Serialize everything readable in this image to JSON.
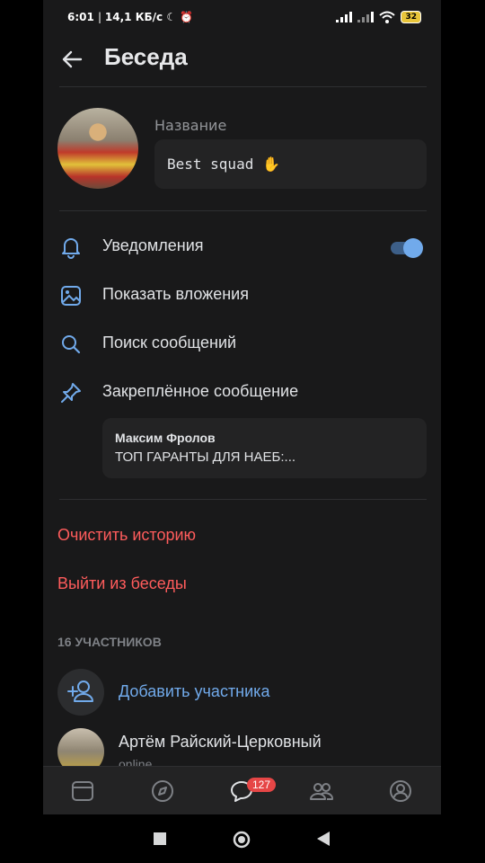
{
  "status_bar": {
    "time": "6:01",
    "network_speed": "14,1 КБ/с",
    "battery": "32"
  },
  "header": {
    "title": "Беседа"
  },
  "chat": {
    "name_label": "Название",
    "name_value": "Best squad"
  },
  "menu": {
    "notifications": "Уведомления",
    "attachments": "Показать вложения",
    "search": "Поиск сообщений",
    "pinned": "Закреплённое сообщение"
  },
  "pinned_message": {
    "author": "Максим Фролов",
    "text": "ТОП ГАРАНТЫ ДЛЯ НАЕБ:..."
  },
  "actions": {
    "clear_history": "Очистить историю",
    "leave": "Выйти из беседы"
  },
  "members": {
    "count_label": "16 УЧАСТНИКОВ",
    "add_label": "Добавить участника",
    "first": {
      "name": "Артём Райский-Церковный",
      "status": "online"
    }
  },
  "tabbar": {
    "messages_badge": "127"
  },
  "colors": {
    "accent": "#71aaeb",
    "danger": "#ff5c5c",
    "background": "#19191a"
  }
}
